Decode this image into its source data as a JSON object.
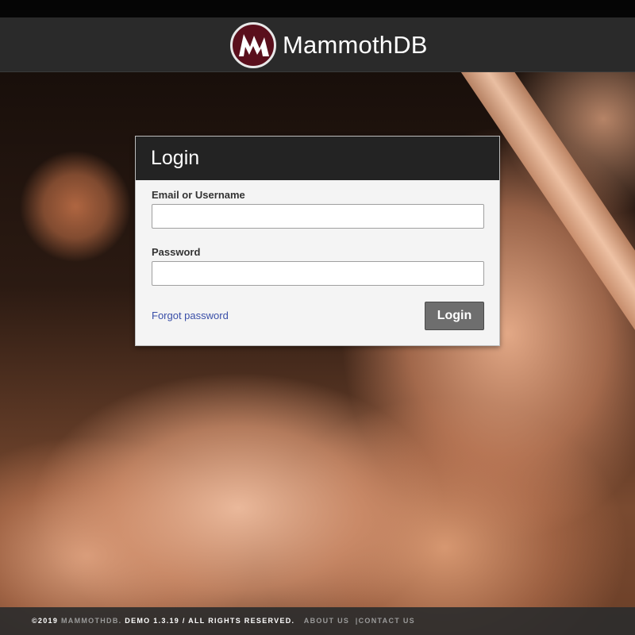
{
  "header": {
    "brand_name": "MammothDB"
  },
  "login_form": {
    "title": "Login",
    "email_label": "Email or Username",
    "email_value": "",
    "password_label": "Password",
    "password_value": "",
    "forgot_password": "Forgot password",
    "submit_label": "Login"
  },
  "footer": {
    "copyright_year": "©2019",
    "company": "MAMMOTHDB.",
    "rights": "DEMO 1.3.19 / ALL RIGHTS RESERVED.",
    "about": "ABOUT US",
    "separator": "|",
    "contact": "CONTACT US"
  },
  "colors": {
    "header_bg": "#2a2a2a",
    "logo_maroon": "#5a0f1c",
    "button_bg": "#6e6e6e",
    "link": "#3a4fa8"
  },
  "icons": {
    "logo": "mammoth-m-logo-icon"
  }
}
